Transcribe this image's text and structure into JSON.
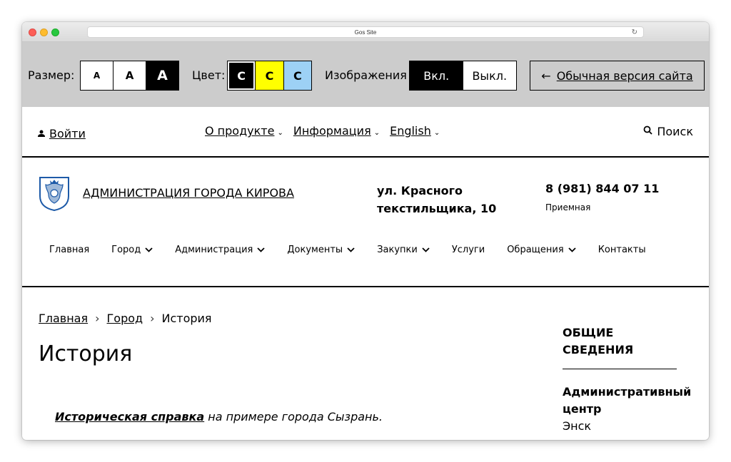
{
  "browser": {
    "title": "Gos Site"
  },
  "a11y": {
    "size_label": "Размер:",
    "size_options": [
      "А",
      "А",
      "А"
    ],
    "color_label": "Цвет:",
    "color_options": [
      "С",
      "С",
      "С"
    ],
    "images_label": "Изображения",
    "images_on": "Вкл.",
    "images_off": "Выкл.",
    "normal_version": "Обычная версия сайта",
    "colors": {
      "yellow": "#ffff00",
      "blue": "#9dd1f5",
      "toolbar_bg": "#cccccc"
    }
  },
  "topnav": {
    "login": "Войти",
    "menu": [
      "О продукте",
      "Информация",
      "English"
    ],
    "search": "Поиск"
  },
  "header": {
    "org_name": "АДМИНИСТРАЦИЯ ГОРОДА КИРОВА",
    "address_line1": "ул. Красного",
    "address_line2": "текстильщика, 10",
    "phone": "8 (981) 844 07 11",
    "phone_note": "Приемная",
    "nav": [
      {
        "label": "Главная",
        "dropdown": false
      },
      {
        "label": "Город",
        "dropdown": true
      },
      {
        "label": "Администрация",
        "dropdown": true
      },
      {
        "label": "Документы",
        "dropdown": true
      },
      {
        "label": "Закупки",
        "dropdown": true
      },
      {
        "label": "Услуги",
        "dropdown": false
      },
      {
        "label": "Обращения",
        "dropdown": true
      },
      {
        "label": "Контакты",
        "dropdown": false
      }
    ]
  },
  "content": {
    "breadcrumb": [
      "Главная",
      "Город",
      "История"
    ],
    "title": "История",
    "lead_strong": "Историческая справка",
    "lead_rest": " на примере города Сызрань."
  },
  "aside": {
    "section_title_1": "ОБЩИЕ",
    "section_title_2": "СВЕДЕНИЯ",
    "key_1": "Административный",
    "key_2": "центр",
    "value": "Энск"
  }
}
